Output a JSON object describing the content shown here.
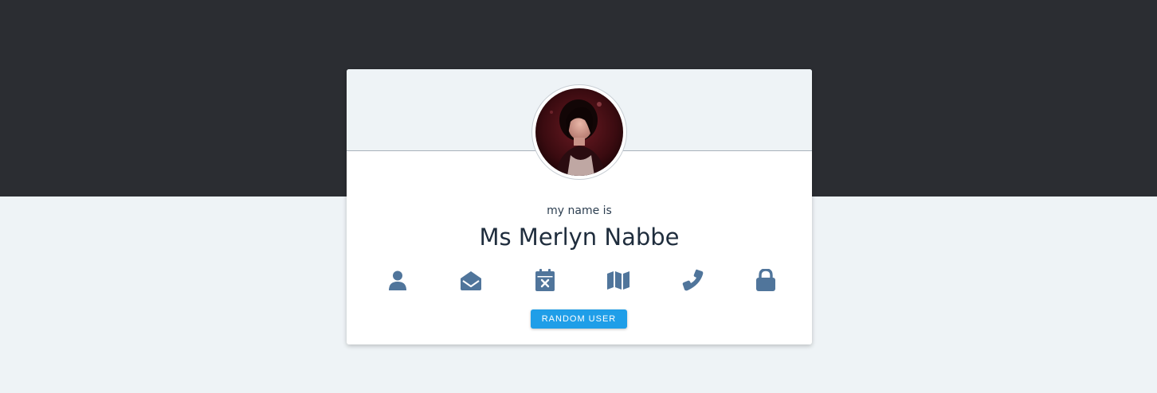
{
  "profile": {
    "label": "my name is",
    "value": "Ms Merlyn Nabbe",
    "avatar_alt": "user avatar"
  },
  "icons": [
    {
      "name": "user-icon"
    },
    {
      "name": "envelope-open-icon"
    },
    {
      "name": "calendar-x-icon"
    },
    {
      "name": "map-icon"
    },
    {
      "name": "phone-icon"
    },
    {
      "name": "lock-icon"
    }
  ],
  "actions": {
    "random_user_label": "RANDOM USER"
  },
  "colors": {
    "top_band": "#2b2d32",
    "page_bg": "#eef3f6",
    "icon": "#50759b",
    "button": "#1f9ee8",
    "text": "#2c3e50"
  }
}
